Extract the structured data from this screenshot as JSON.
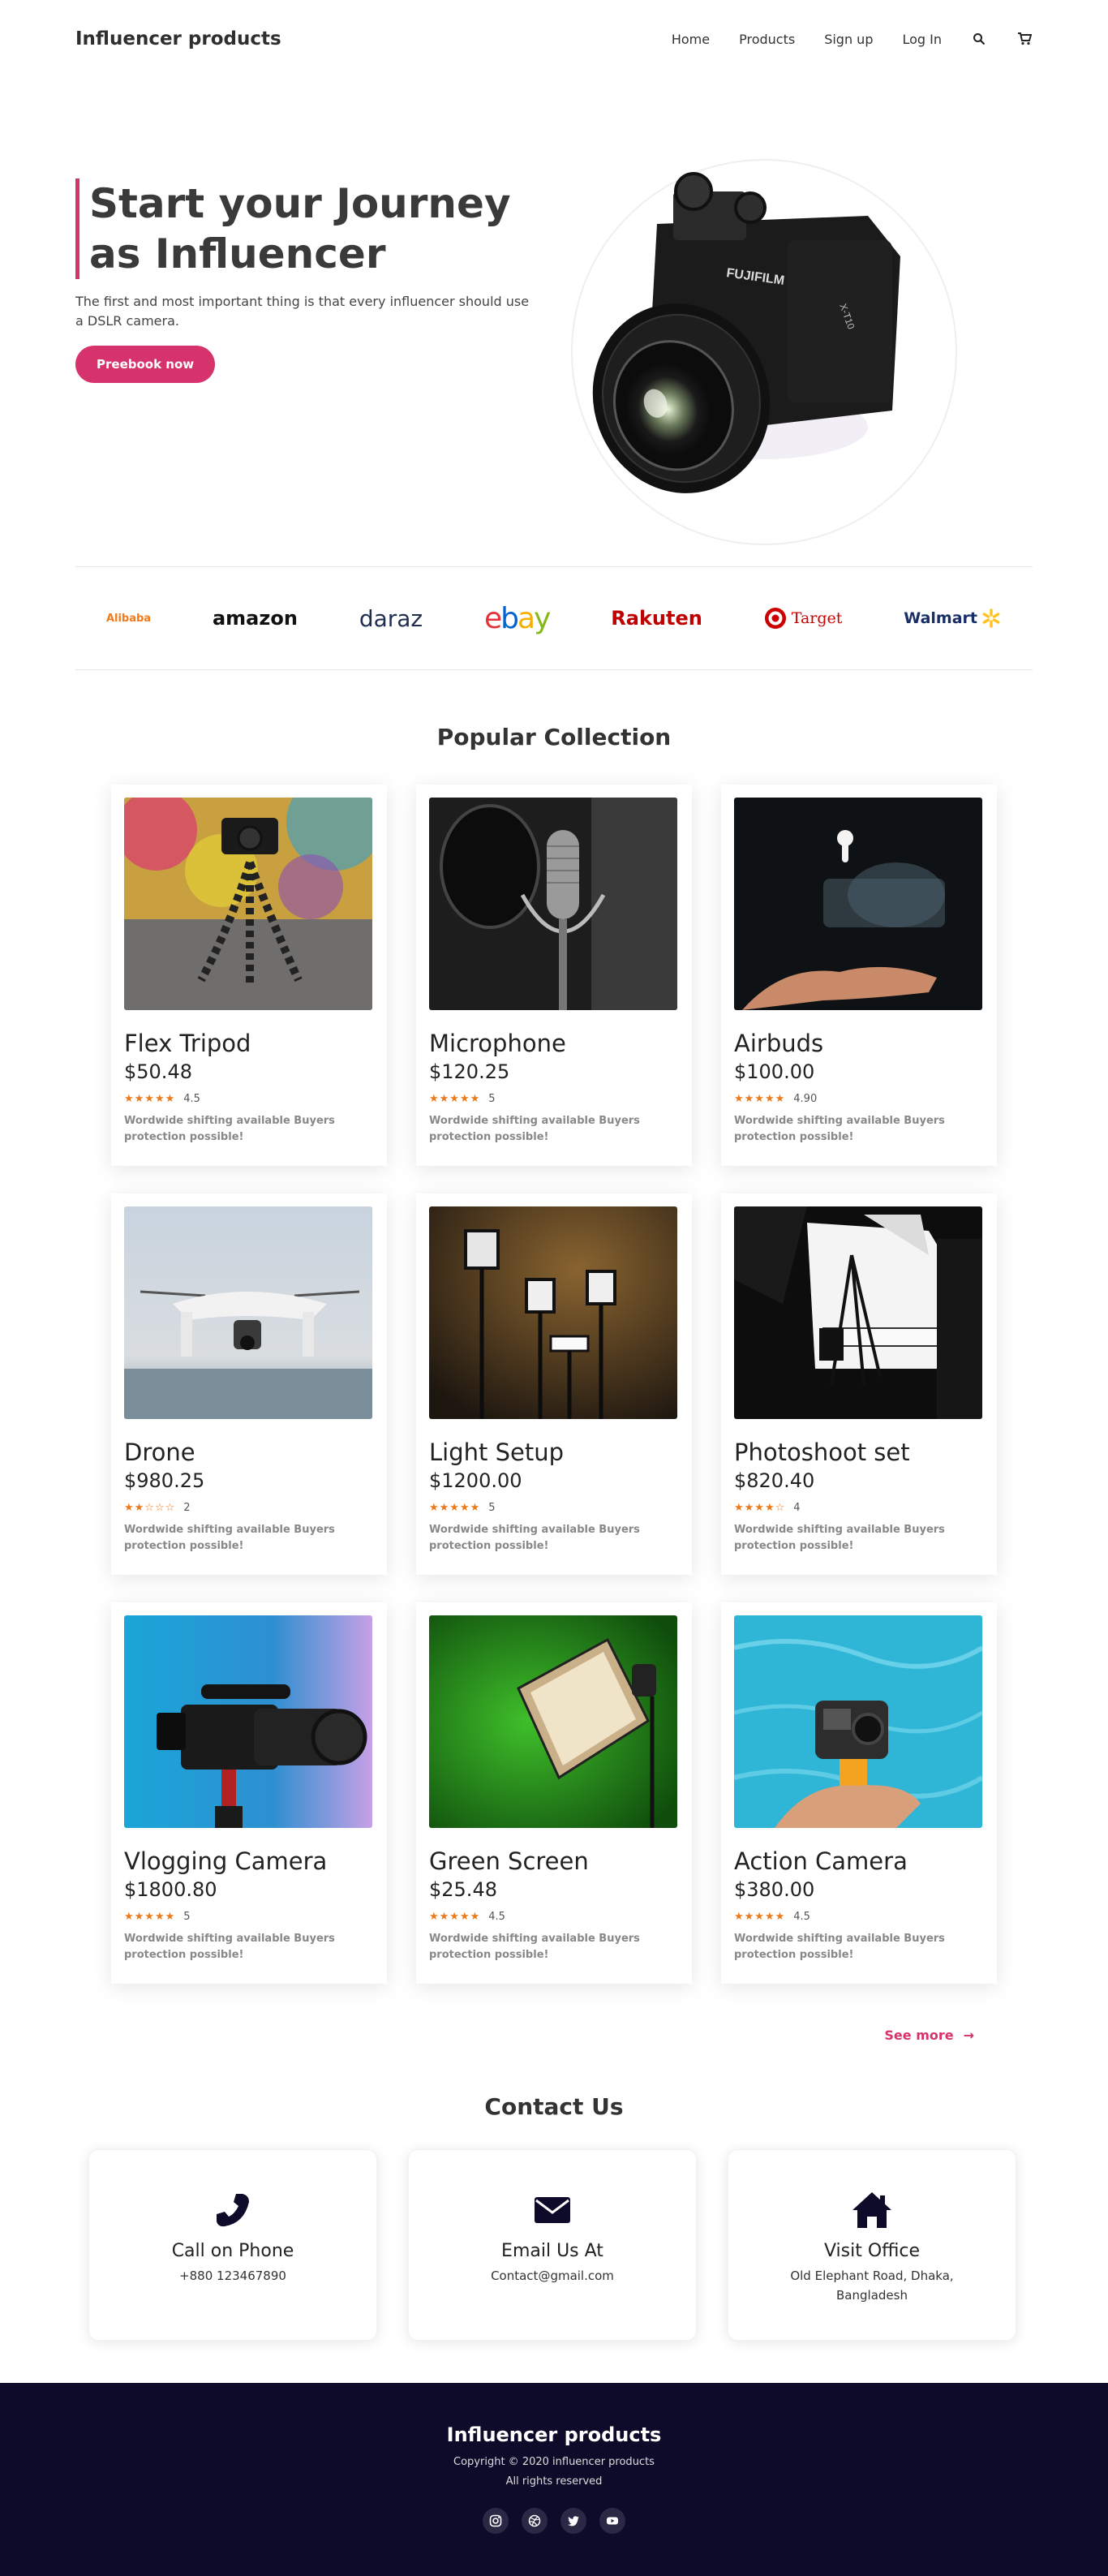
{
  "nav": {
    "brand": "Influencer products",
    "links": [
      "Home",
      "Products",
      "Sign up",
      "Log In"
    ],
    "icons": [
      "search-icon",
      "cart-icon"
    ]
  },
  "hero": {
    "title_line1": "Start your Journey",
    "title_line2": "as Influencer",
    "subtitle": "The first and most important thing is that every influencer should use a DSLR camera.",
    "cta": "Preebook now",
    "camera_brand": "FUJIFILM",
    "camera_model": "X-T10"
  },
  "brands": [
    "Alibaba",
    "amazon",
    "daraz",
    "ebay",
    "Rakuten",
    "Target",
    "Walmart"
  ],
  "collection": {
    "title": "Popular Collection",
    "products": [
      {
        "name": "Flex Tripod",
        "price": "$50.48",
        "stars": "★★★★★",
        "rating": "4.5",
        "desc": "Wordwide shifting available Buyers protection possible!"
      },
      {
        "name": "Microphone",
        "price": "$120.25",
        "stars": "★★★★★",
        "rating": "5",
        "desc": "Wordwide shifting available Buyers protection possible!"
      },
      {
        "name": "Airbuds",
        "price": "$100.00",
        "stars": "★★★★★",
        "rating": "4.90",
        "desc": "Wordwide shifting available Buyers protection possible!"
      },
      {
        "name": "Drone",
        "price": "$980.25",
        "stars": "★★☆☆☆",
        "rating": "2",
        "desc": "Wordwide shifting available Buyers protection possible!"
      },
      {
        "name": "Light Setup",
        "price": "$1200.00",
        "stars": "★★★★★",
        "rating": "5",
        "desc": "Wordwide shifting available Buyers protection possible!"
      },
      {
        "name": "Photoshoot set",
        "price": "$820.40",
        "stars": "★★★★☆",
        "rating": "4",
        "desc": "Wordwide shifting available Buyers protection possible!"
      },
      {
        "name": "Vlogging Camera",
        "price": "$1800.80",
        "stars": "★★★★★",
        "rating": "5",
        "desc": "Wordwide shifting available Buyers protection possible!"
      },
      {
        "name": "Green Screen",
        "price": "$25.48",
        "stars": "★★★★★",
        "rating": "4.5",
        "desc": "Wordwide shifting available Buyers protection possible!"
      },
      {
        "name": "Action Camera",
        "price": "$380.00",
        "stars": "★★★★★",
        "rating": "4.5",
        "desc": "Wordwide shifting available Buyers protection possible!"
      }
    ],
    "see_more": "See more",
    "see_more_arrow": "→"
  },
  "contact": {
    "title": "Contact Us",
    "cards": [
      {
        "title": "Call on Phone",
        "text": "+880 123467890",
        "icon": "phone-icon"
      },
      {
        "title": "Email Us At",
        "text": "Contact@gmail.com",
        "icon": "envelope-icon"
      },
      {
        "title": "Visit Office",
        "text": "Old Elephant Road, Dhaka, Bangladesh",
        "icon": "home-icon"
      }
    ]
  },
  "footer": {
    "brand": "Influencer products",
    "copyright": "Copyright © 2020 influencer products",
    "rights": "All rights reserved",
    "socials": [
      "instagram-icon",
      "dribbble-icon",
      "twitter-icon",
      "youtube-icon"
    ]
  },
  "colors": {
    "accent": "#d6336c",
    "footer_bg": "#0e0b2a",
    "star": "#ec7a1a"
  }
}
